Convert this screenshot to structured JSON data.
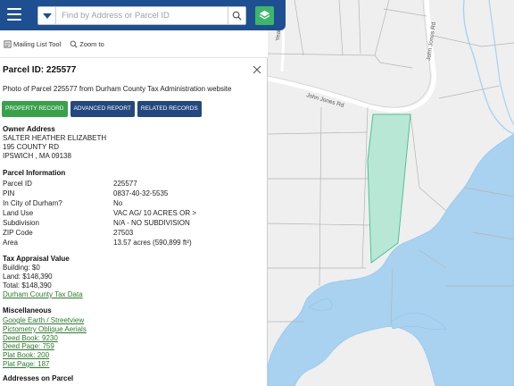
{
  "search": {
    "placeholder": "Find by Address or Parcel ID"
  },
  "toolbar": {
    "mailing_list": "Mailing List Tool",
    "zoom_to": "Zoom to"
  },
  "panel": {
    "title": "Parcel ID: 225577",
    "photo_link": "Photo of Parcel 225577 from Durham County Tax Administration website",
    "buttons": {
      "property_record": "PROPERTY RECORD",
      "advanced_report": "ADVANCED REPORT",
      "related_records": "RELATED RECORDS"
    }
  },
  "owner": {
    "heading": "Owner Address",
    "lines": [
      "SALTER HEATHER ELIZABETH",
      "195 COUNTY RD",
      "IPSWICH , MA 09138"
    ]
  },
  "parcel_info": {
    "heading": "Parcel Information",
    "rows": [
      {
        "label": "Parcel ID",
        "value": "225577"
      },
      {
        "label": "PIN",
        "value": "0837-40-32-5535"
      },
      {
        "label": "In City of Durham?",
        "value": "No"
      },
      {
        "label": "Land Use",
        "value": "VAC AG/ 10 ACRES OR >"
      },
      {
        "label": "Subdivision",
        "value": "N/A - NO SUBDIVISION"
      },
      {
        "label": "ZIP Code",
        "value": "27503"
      },
      {
        "label": "Area",
        "value": "13.57 acres (590,899 ft²)"
      }
    ]
  },
  "tax": {
    "heading": "Tax Appraisal Value",
    "building": "Building: $0",
    "land": "Land: $148,390",
    "total": "Total: $148,390",
    "link": "Durham County Tax Data"
  },
  "misc": {
    "heading": "Miscellaneous",
    "links": [
      "Google Earth / Streetview",
      "Pictometry Oblique Aerials",
      "Deed Book: 9230",
      "Deed Page: 759",
      "Plat Book: 200",
      "Plat Page: 187"
    ]
  },
  "addresses": {
    "heading": "Addresses on Parcel"
  },
  "map": {
    "road_labels": [
      "John Jones Rd",
      "John Jones Rd",
      "Yeat"
    ],
    "colors": {
      "land": "#efefef",
      "water": "#a8d2f0",
      "parcel_fill": "#a6e6cc",
      "parcel_stroke": "#4cc296",
      "lines": "#b5b5b5"
    }
  }
}
